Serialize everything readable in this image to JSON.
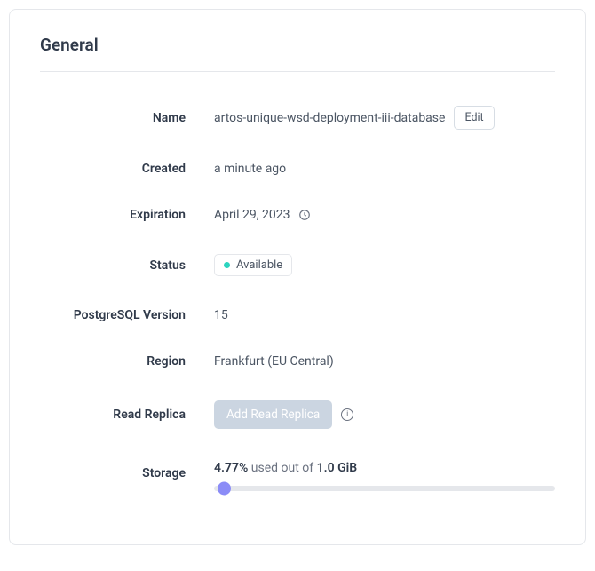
{
  "section": {
    "title": "General"
  },
  "fields": {
    "name": {
      "label": "Name",
      "value": "artos-unique-wsd-deployment-iii-database",
      "edit_label": "Edit"
    },
    "created": {
      "label": "Created",
      "value": "a minute ago"
    },
    "expiration": {
      "label": "Expiration",
      "value": "April 29, 2023"
    },
    "status": {
      "label": "Status",
      "value": "Available"
    },
    "pg_version": {
      "label": "PostgreSQL Version",
      "value": "15"
    },
    "region": {
      "label": "Region",
      "value": "Frankfurt (EU Central)"
    },
    "read_replica": {
      "label": "Read Replica",
      "button": "Add Read Replica"
    },
    "storage": {
      "label": "Storage",
      "percent": "4.77%",
      "middle": " used out of ",
      "total": "1.0 GiB"
    }
  }
}
